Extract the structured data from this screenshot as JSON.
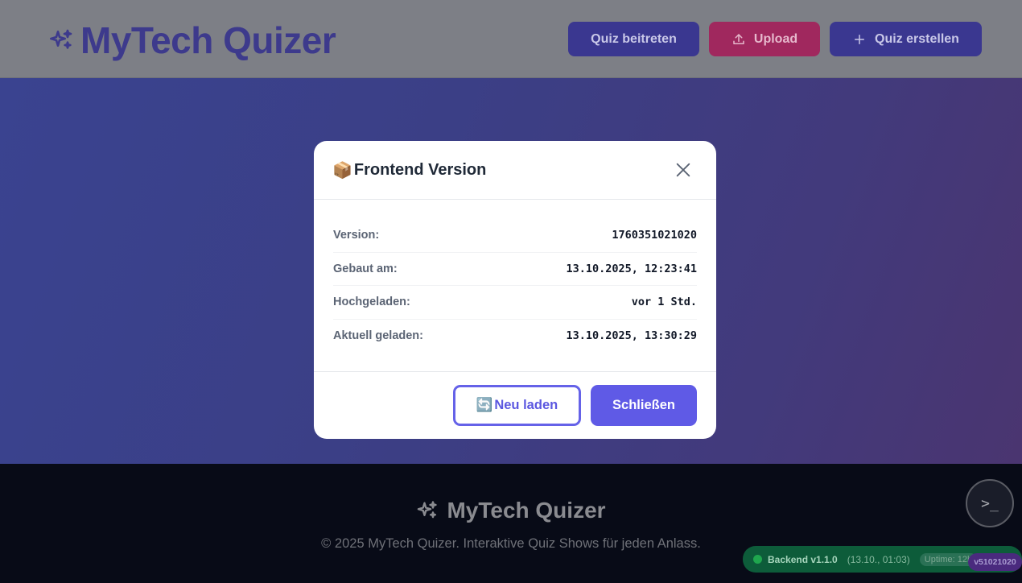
{
  "header": {
    "app_title": "MyTech Quizer",
    "buttons": {
      "join": "Quiz beitreten",
      "upload": "Upload",
      "create": "Quiz erstellen"
    }
  },
  "modal": {
    "icon": "📦",
    "title": "Frontend Version",
    "rows": [
      {
        "label": "Version:",
        "value": "1760351021020"
      },
      {
        "label": "Gebaut am:",
        "value": "13.10.2025, 12:23:41"
      },
      {
        "label": "Hochgeladen:",
        "value": "vor 1 Std."
      },
      {
        "label": "Aktuell geladen:",
        "value": "13.10.2025, 13:30:29"
      }
    ],
    "reload_icon": "🔄",
    "reload_label": "Neu laden",
    "close_label": "Schließen"
  },
  "footer": {
    "app_title": "MyTech Quizer",
    "copyright": "© 2025 MyTech Quizer. Interaktive Quiz Shows für jeden Anlass."
  },
  "status": {
    "backend_label": "Backend v1.1.0",
    "backend_time": "(13.10., 01:03)",
    "uptime": "Uptime: 12h",
    "version_badge": "v51021020",
    "terminal_glyph": ">_"
  },
  "colors": {
    "accent": "#5f5ae6",
    "upload": "#a0285e",
    "status_ok": "#1fa64e"
  }
}
